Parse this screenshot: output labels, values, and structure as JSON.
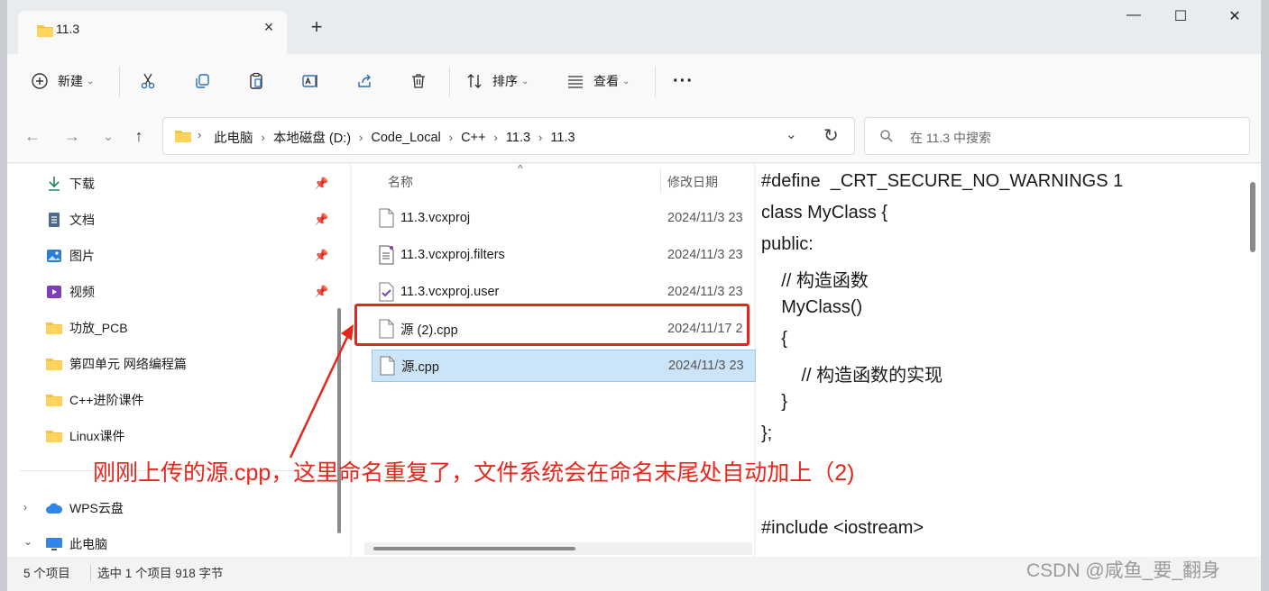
{
  "window": {
    "tab_title": "11.3",
    "tab_close": "×",
    "new_tab": "+",
    "controls": {
      "minimize": "—",
      "maximize": "☐",
      "close": "✕"
    }
  },
  "toolbar": {
    "new_label": "新建",
    "sort_label": "排序",
    "view_label": "查看",
    "more_label": "···"
  },
  "address": {
    "crumbs": [
      "此电脑",
      "本地磁盘 (D:)",
      "Code_Local",
      "C++",
      "11.3",
      "11.3"
    ],
    "search_placeholder": "在 11.3 中搜索"
  },
  "nav": {
    "quick": [
      {
        "label": "下载",
        "icon": "download-icon"
      },
      {
        "label": "文档",
        "icon": "document-icon"
      },
      {
        "label": "图片",
        "icon": "picture-icon"
      },
      {
        "label": "视频",
        "icon": "video-icon"
      }
    ],
    "folders": [
      "功放_PCB",
      "第四单元 网络编程篇",
      "C++进阶课件",
      "Linux课件"
    ],
    "bottom": [
      {
        "label": "WPS云盘",
        "icon": "cloud-icon"
      },
      {
        "label": "此电脑",
        "icon": "computer-icon"
      }
    ]
  },
  "files": {
    "col_name": "名称",
    "col_date": "修改日期",
    "rows": [
      {
        "name": "11.3.vcxproj",
        "date": "2024/11/3 23"
      },
      {
        "name": "11.3.vcxproj.filters",
        "date": "2024/11/3 23"
      },
      {
        "name": "11.3.vcxproj.user",
        "date": "2024/11/3 23"
      },
      {
        "name": "源 (2).cpp",
        "date": "2024/11/17 2"
      },
      {
        "name": "源.cpp",
        "date": "2024/11/3 23"
      }
    ]
  },
  "preview": {
    "lines": [
      "#define  _CRT_SECURE_NO_WARNINGS 1",
      "class MyClass {",
      "public:",
      "    // 构造函数",
      "    MyClass()",
      "    {",
      "        // 构造函数的实现",
      "    }",
      "};",
      "",
      "#include <iostream>"
    ]
  },
  "status": {
    "count": "5 个项目",
    "selected": "选中 1 个项目  918 字节"
  },
  "annotation": {
    "text": "刚刚上传的源.cpp，这里命名重复了，文件系统会在命名末尾处自动加上（2)",
    "color": "#e8251a"
  },
  "watermark": "CSDN @咸鱼_要_翻身",
  "colors": {
    "selection": "#cce4f7",
    "accent": "#e8251a",
    "folder": "#f5c342"
  }
}
